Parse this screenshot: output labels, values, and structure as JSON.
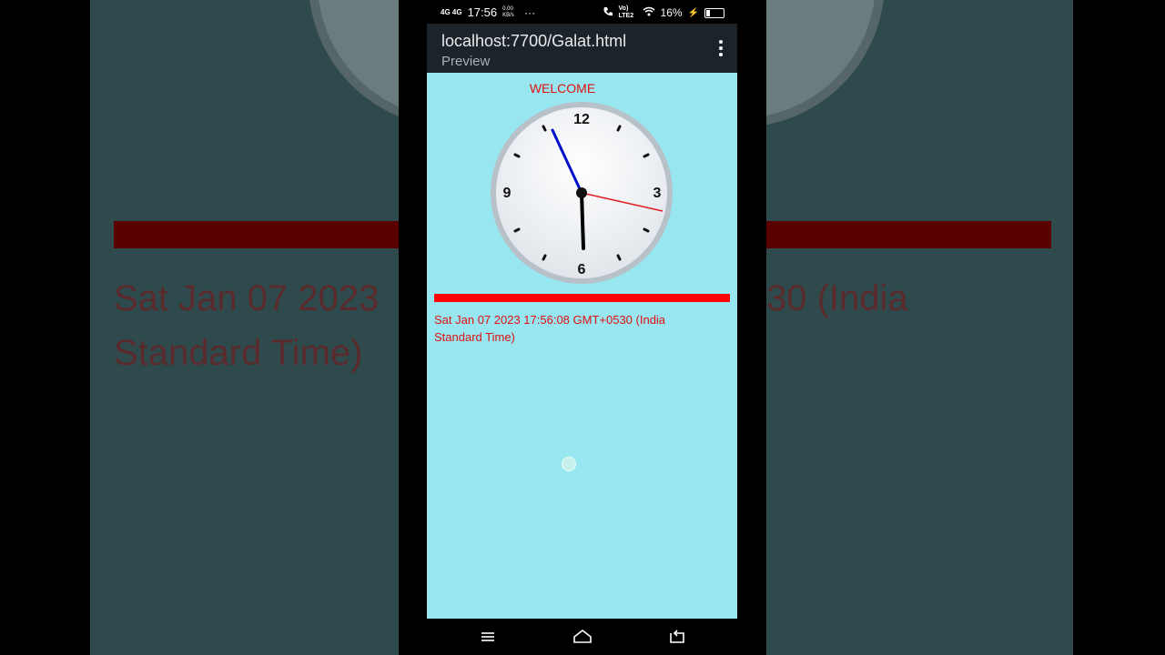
{
  "status_bar": {
    "network": "4G 4G",
    "time": "17:56",
    "speed": "0.00 KB/s",
    "more": "···",
    "carrier": "Vo) LTE2",
    "battery": "16%"
  },
  "app_bar": {
    "url": "localhost:7700/Galat.html",
    "subtitle": "Preview"
  },
  "page": {
    "welcome": "WELCOME",
    "datetime": "Sat Jan 07 2023 17:56:08 GMT+0530 (India Standard Time)",
    "clock": {
      "numerals": [
        "12",
        "3",
        "6",
        "9"
      ],
      "hour_hand_color": "#000000",
      "minute_hand_color": "#0010c8",
      "second_hand_color": "#e02020"
    }
  },
  "background": {
    "text_line1_left": "Sat Jan 07 2023",
    "text_line2_left": "Standard Time)",
    "text_line1_right": "30 (India"
  },
  "nav_bar": {
    "icons": [
      "menu-icon",
      "home-icon",
      "back-icon"
    ]
  },
  "colors": {
    "accent_red": "#ff0000",
    "page_bg": "#98e6ef",
    "appbar_bg": "#1c242a"
  }
}
